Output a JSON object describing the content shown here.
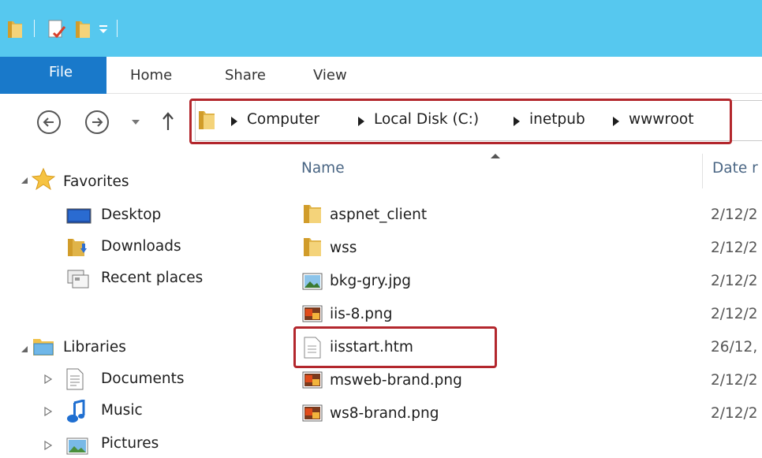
{
  "ribbon": {
    "tabs": [
      "File",
      "Home",
      "Share",
      "View"
    ]
  },
  "address_bar": {
    "breadcrumbs": [
      "Computer",
      "Local Disk (C:)",
      "inetpub",
      "wwwroot"
    ]
  },
  "nav_pane": {
    "favorites_label": "Favorites",
    "favorites": [
      "Desktop",
      "Downloads",
      "Recent places"
    ],
    "libraries_label": "Libraries",
    "libraries": [
      "Documents",
      "Music",
      "Pictures"
    ]
  },
  "file_list": {
    "columns": [
      "Name",
      "Date r"
    ],
    "rows": [
      {
        "name": "aspnet_client",
        "date": "2/12/2",
        "icon": "folder-icon"
      },
      {
        "name": "wss",
        "date": "2/12/2",
        "icon": "folder-icon"
      },
      {
        "name": "bkg-gry.jpg",
        "date": "2/12/2",
        "icon": "image-file-icon"
      },
      {
        "name": "iis-8.png",
        "date": "2/12/2",
        "icon": "png-file-icon"
      },
      {
        "name": "iisstart.htm",
        "date": "26/12,",
        "icon": "document-file-icon"
      },
      {
        "name": "msweb-brand.png",
        "date": "2/12/2",
        "icon": "png-file-icon"
      },
      {
        "name": "ws8-brand.png",
        "date": "2/12/2",
        "icon": "png-file-icon"
      }
    ]
  },
  "colors": {
    "titlebar": "#56c8ef",
    "file_tab": "#1979ca",
    "highlight": "#b3272d"
  }
}
